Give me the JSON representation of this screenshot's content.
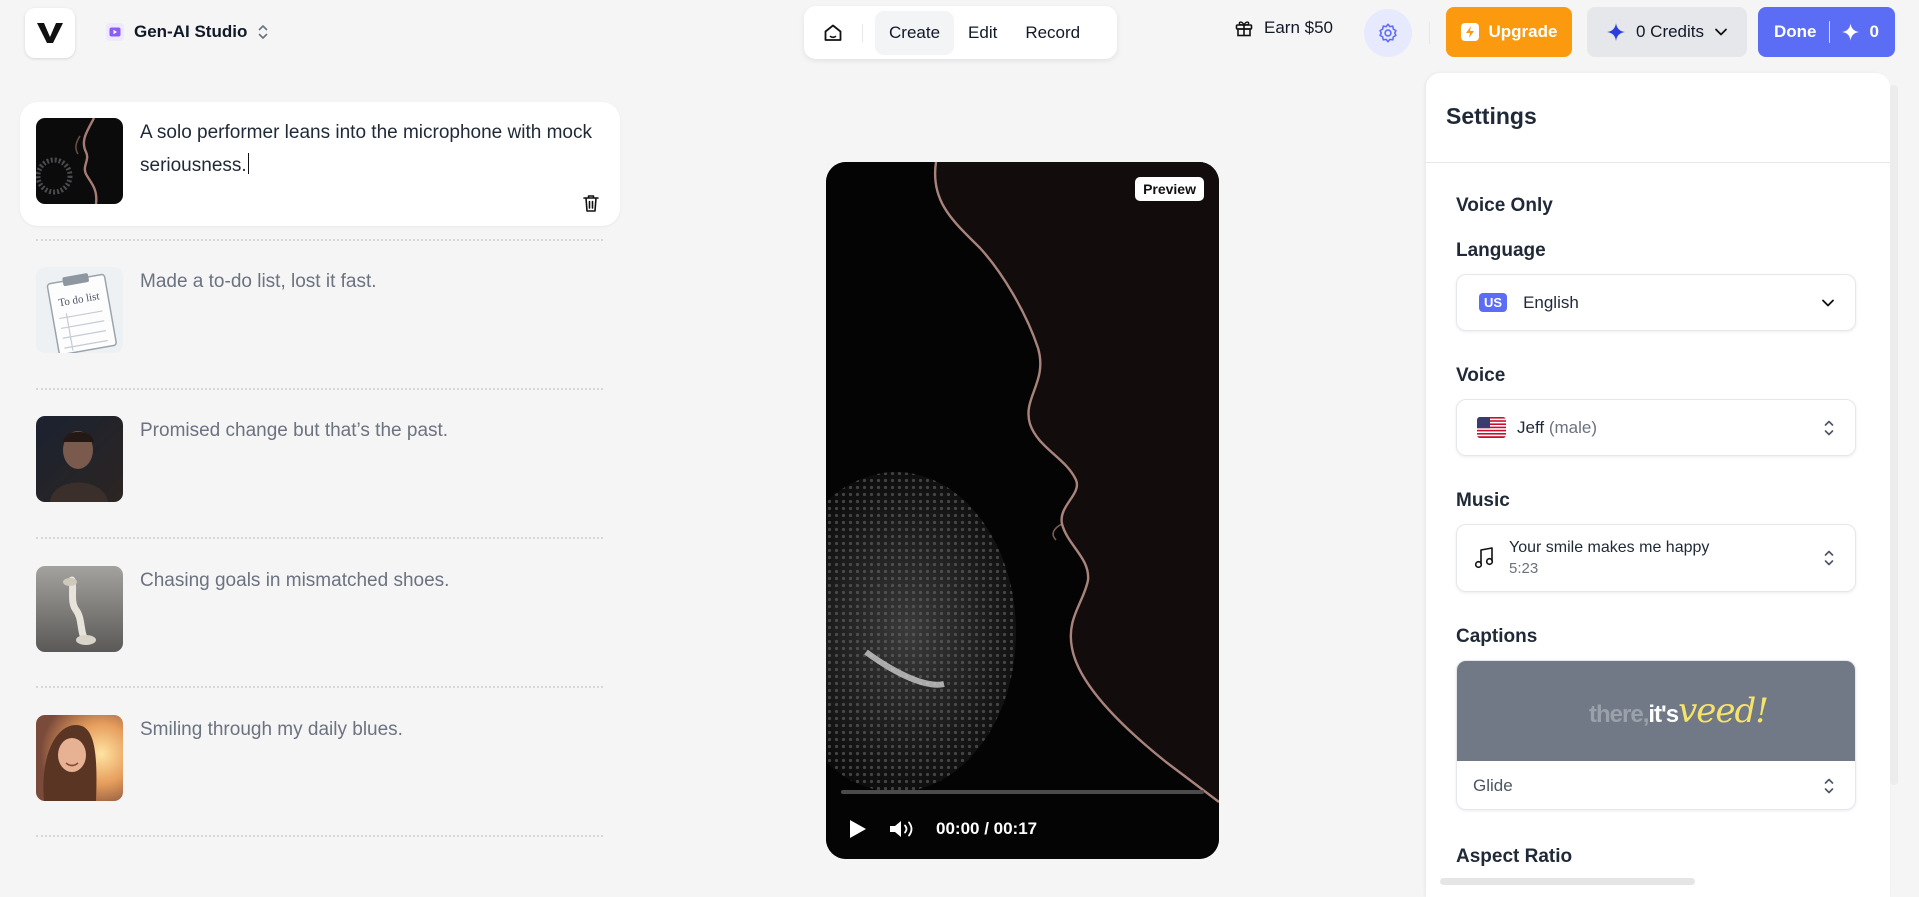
{
  "header": {
    "logo": "V",
    "workspace": "Gen-AI Studio",
    "nav": [
      {
        "label": "Create",
        "active": true
      },
      {
        "label": "Edit",
        "active": false
      },
      {
        "label": "Record",
        "active": false
      }
    ],
    "earn_label": "Earn $50",
    "upgrade_label": "Upgrade",
    "credits_label": "0 Credits",
    "done_label": "Done",
    "done_count": "0"
  },
  "scenes": [
    {
      "text": "A solo performer leans into the microphone with mock seriousness.",
      "active": true
    },
    {
      "text": "Made a to-do list, lost it fast.",
      "thumb_label": "To do list"
    },
    {
      "text": "Promised change but that’s the past."
    },
    {
      "text": "Chasing goals in mismatched shoes."
    },
    {
      "text": "Smiling through my daily blues."
    }
  ],
  "preview": {
    "badge": "Preview",
    "time": "00:00 / 00:17",
    "progress": 0
  },
  "settings": {
    "title": "Settings",
    "voice_only": "Voice Only",
    "language_label": "Language",
    "language_badge": "US",
    "language_value": "English",
    "voice_label": "Voice",
    "voice_name": "Jeff",
    "voice_gender": "(male)",
    "music_label": "Music",
    "music_title": "Your smile makes me happy",
    "music_duration": "5:23",
    "captions_label": "Captions",
    "caption_word1": "there,",
    "caption_word2": "it's",
    "caption_word3": "veed!",
    "caption_style": "Glide",
    "aspect_label": "Aspect Ratio"
  },
  "colors": {
    "accent": "#5b6cf5",
    "upgrade": "#fb9a0e",
    "background": "#f5f5f5"
  }
}
